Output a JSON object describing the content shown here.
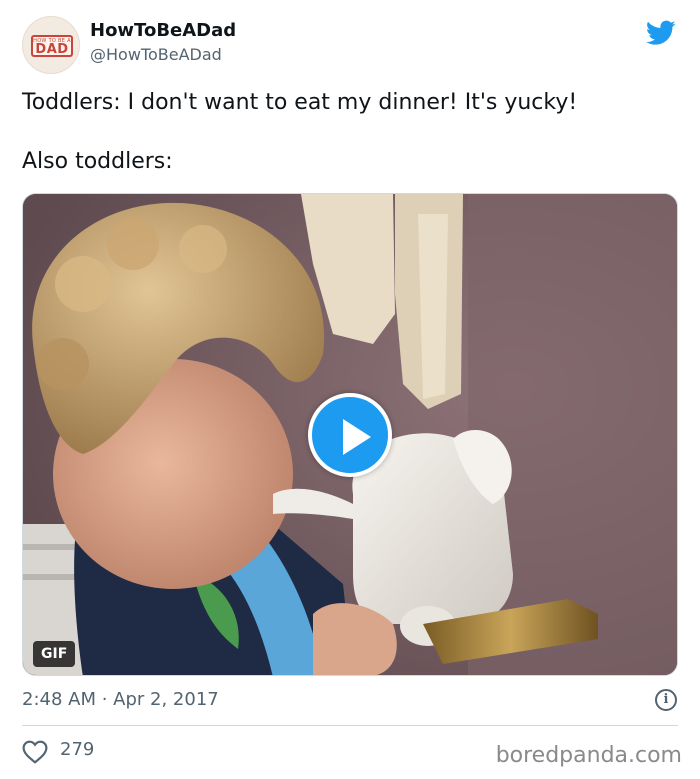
{
  "author": {
    "display_name": "HowToBeADad",
    "handle": "@HowToBeADad",
    "avatar_text_small": "HOW TO BE A",
    "avatar_text_big": "DAD",
    "avatar_icon": "how-to-be-a-dad-logo"
  },
  "platform_icon": "twitter-bird-icon",
  "tweet": {
    "line1": "Toddlers: I don't want to eat my dinner! It's yucky!",
    "line2": "Also toddlers:"
  },
  "media": {
    "badge": "GIF",
    "play_icon": "play-icon"
  },
  "meta": {
    "timestamp": "2:48 AM · Apr 2, 2017",
    "info_icon_glyph": "i",
    "likes": "279",
    "like_icon": "heart-icon"
  },
  "watermark": "boredpanda.com",
  "colors": {
    "accent": "#1d9bf0",
    "text_primary": "#0f1419",
    "text_secondary": "#536471",
    "divider": "#cfd9de"
  }
}
